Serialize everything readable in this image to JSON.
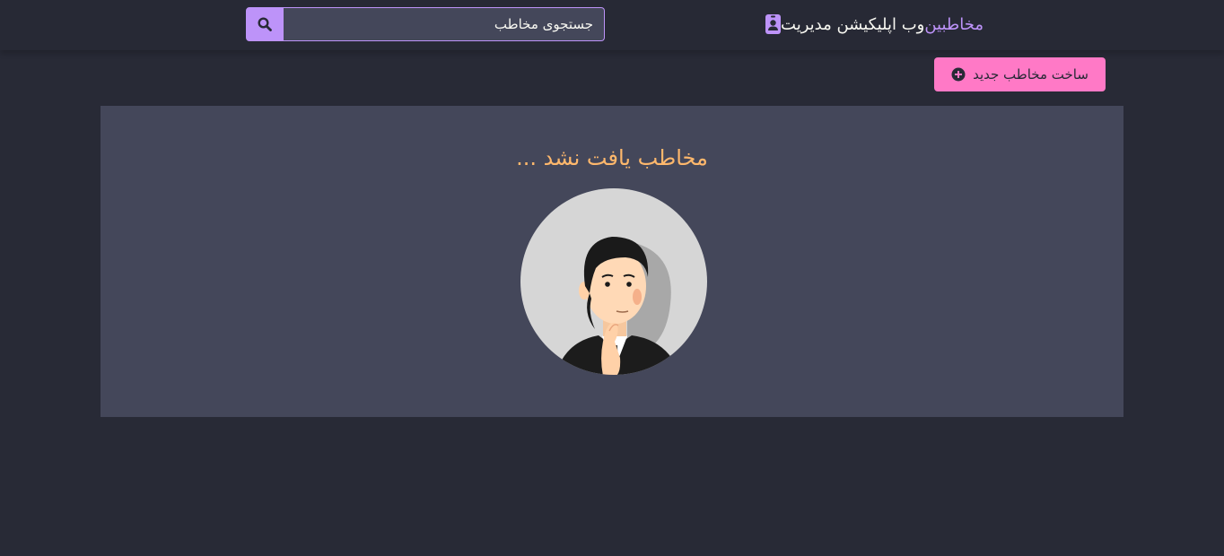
{
  "navbar": {
    "brand_text": "وب اپلیکیشن مدیریت",
    "brand_accent": "مخاطبین",
    "brand_icon": "contact-card-icon",
    "search": {
      "placeholder": "جستجوی مخاطب",
      "value": "",
      "button_icon": "search-icon"
    }
  },
  "actions": {
    "add_contact_label": "ساخت مخاطب جدید",
    "add_contact_icon": "plus-circle-icon"
  },
  "main": {
    "empty_message": "مخاطب یافت نشد ...",
    "illustration": "thinking-man-avatar"
  },
  "colors": {
    "background": "#282a36",
    "panel": "#44475a",
    "purple": "#bd93f9",
    "pink": "#ff79c6",
    "orange": "#ffb86c",
    "foreground": "#f8f8f2"
  }
}
